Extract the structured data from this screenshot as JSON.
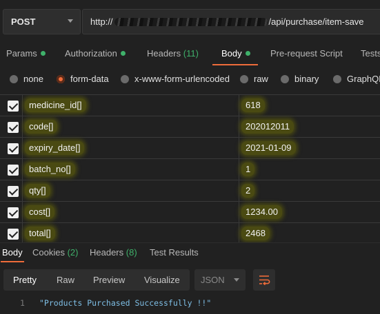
{
  "request": {
    "method": "POST",
    "url_prefix": "http://",
    "url_suffix": "/api/purchase/item-save"
  },
  "request_tabs": [
    {
      "label": "Params",
      "dot": true,
      "count": ""
    },
    {
      "label": "Authorization",
      "dot": true,
      "count": ""
    },
    {
      "label": "Headers",
      "dot": false,
      "count": "(11)"
    },
    {
      "label": "Body",
      "dot": true,
      "count": "",
      "active": true
    },
    {
      "label": "Pre-request Script",
      "dot": false,
      "count": ""
    },
    {
      "label": "Tests",
      "dot": false,
      "count": ""
    }
  ],
  "body_types": [
    {
      "label": "none",
      "selected": false
    },
    {
      "label": "form-data",
      "selected": true
    },
    {
      "label": "x-www-form-urlencoded",
      "selected": false
    },
    {
      "label": "raw",
      "selected": false
    },
    {
      "label": "binary",
      "selected": false
    },
    {
      "label": "GraphQL",
      "selected": false
    }
  ],
  "form_data": [
    {
      "key": "medicine_id[]",
      "value": "618",
      "checked": true
    },
    {
      "key": "code[]",
      "value": "202012011",
      "checked": true
    },
    {
      "key": "expiry_date[]",
      "value": "2021-01-09",
      "checked": true
    },
    {
      "key": "batch_no[]",
      "value": "1",
      "checked": true
    },
    {
      "key": "qty[]",
      "value": "2",
      "checked": true
    },
    {
      "key": "cost[]",
      "value": "1234.00",
      "checked": true
    },
    {
      "key": "total[]",
      "value": "2468",
      "checked": true
    }
  ],
  "response_tabs": [
    {
      "label": "Body",
      "count": "",
      "active": true
    },
    {
      "label": "Cookies",
      "count": "(2)"
    },
    {
      "label": "Headers",
      "count": "(8)"
    },
    {
      "label": "Test Results",
      "count": ""
    }
  ],
  "response_views": [
    "Pretty",
    "Raw",
    "Preview",
    "Visualize"
  ],
  "response_format": "JSON",
  "response_lines": [
    {
      "no": "1",
      "text": "\"Products Purchased Successfully !!\""
    }
  ],
  "colors": {
    "accent": "#ef6c3a",
    "status_dot": "#3fb16a",
    "highlight": "#4a4a12",
    "string": "#7fbfe6"
  },
  "icons": {
    "method_dropdown": "chevron-down-icon",
    "checkbox": "checkmark-icon",
    "wrap": "wrap-lines-icon"
  }
}
